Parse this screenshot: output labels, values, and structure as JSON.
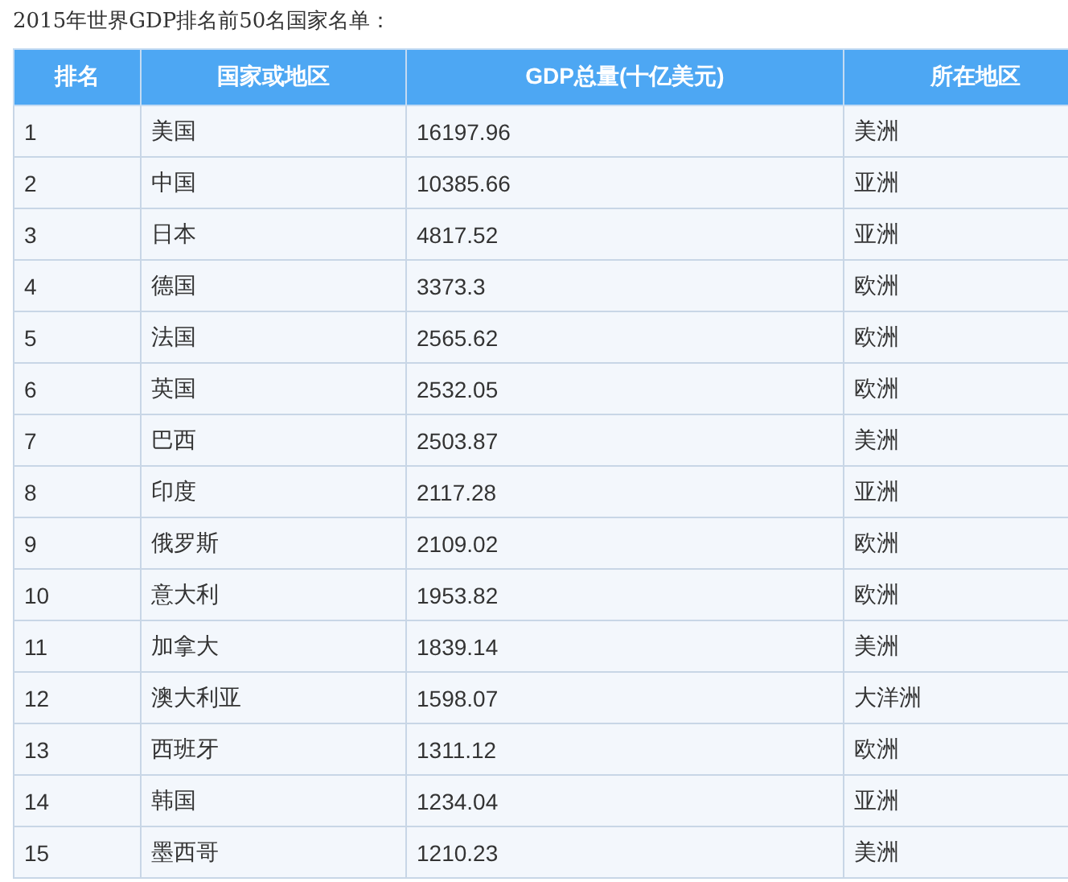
{
  "title": "2015年世界GDP排名前50名国家名单：",
  "table": {
    "columns": [
      "排名",
      "国家或地区",
      "GDP总量(十亿美元)",
      "所在地区"
    ],
    "rows": [
      [
        "1",
        "美国",
        "16197.96",
        "美洲"
      ],
      [
        "2",
        "中国",
        "10385.66",
        "亚洲"
      ],
      [
        "3",
        "日本",
        "4817.52",
        "亚洲"
      ],
      [
        "4",
        "德国",
        "3373.3",
        "欧洲"
      ],
      [
        "5",
        "法国",
        "2565.62",
        "欧洲"
      ],
      [
        "6",
        "英国",
        "2532.05",
        "欧洲"
      ],
      [
        "7",
        "巴西",
        "2503.87",
        "美洲"
      ],
      [
        "8",
        "印度",
        "2117.28",
        "亚洲"
      ],
      [
        "9",
        "俄罗斯",
        "2109.02",
        "欧洲"
      ],
      [
        "10",
        "意大利",
        "1953.82",
        "欧洲"
      ],
      [
        "11",
        "加拿大",
        "1839.14",
        "美洲"
      ],
      [
        "12",
        "澳大利亚",
        "1598.07",
        "大洋洲"
      ],
      [
        "13",
        "西班牙",
        "1311.12",
        "欧洲"
      ],
      [
        "14",
        "韩国",
        "1234.04",
        "亚洲"
      ],
      [
        "15",
        "墨西哥",
        "1210.23",
        "美洲"
      ]
    ]
  }
}
